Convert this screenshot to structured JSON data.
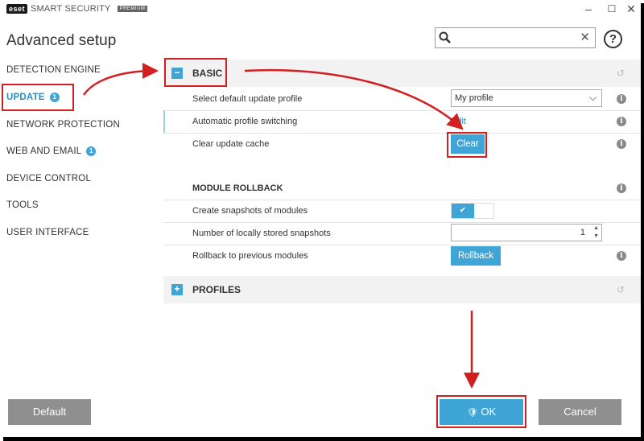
{
  "titlebar": {
    "logo": "eset",
    "product": "SMART SECURITY",
    "edition": "PREMIUM",
    "minimize": "–",
    "maximize": "☐",
    "close": "✕"
  },
  "header": {
    "title": "Advanced setup",
    "search": {
      "value": "",
      "placeholder": ""
    },
    "search_clear": "✕",
    "help": "?"
  },
  "sidebar": {
    "items": [
      {
        "label": "DETECTION ENGINE",
        "badge": ""
      },
      {
        "label": "UPDATE",
        "badge": "1",
        "active": true
      },
      {
        "label": "NETWORK PROTECTION",
        "badge": ""
      },
      {
        "label": "WEB AND EMAIL",
        "badge": "1"
      },
      {
        "label": "DEVICE CONTROL",
        "badge": ""
      },
      {
        "label": "TOOLS",
        "badge": ""
      },
      {
        "label": "USER INTERFACE",
        "badge": ""
      }
    ]
  },
  "basic": {
    "expander": "−",
    "title": "BASIC",
    "rows": {
      "profile": {
        "label": "Select default update profile",
        "value": "My profile"
      },
      "switching": {
        "label": "Automatic profile switching",
        "link": "Edit"
      },
      "cache": {
        "label": "Clear update cache",
        "button": "Clear"
      }
    },
    "rollback": {
      "title": "MODULE ROLLBACK",
      "snapshots": {
        "label": "Create snapshots of modules",
        "checked": true
      },
      "count": {
        "label": "Number of locally stored snapshots",
        "value": "1"
      },
      "rollback": {
        "label": "Rollback to previous modules",
        "button": "Rollback"
      }
    }
  },
  "profiles": {
    "expander": "+",
    "title": "PROFILES"
  },
  "icons": {
    "info": "i",
    "revert": "↺",
    "check": "✔",
    "chevron": "⌵",
    "spin_up": "▲",
    "spin_down": "▼",
    "shield": "🛡"
  },
  "footer": {
    "default_label": "Default",
    "ok_label": "OK",
    "cancel_label": "Cancel"
  },
  "colors": {
    "accent": "#3fa5d6",
    "annotation": "#d21f1f",
    "button_gray": "#8f8f8f"
  }
}
